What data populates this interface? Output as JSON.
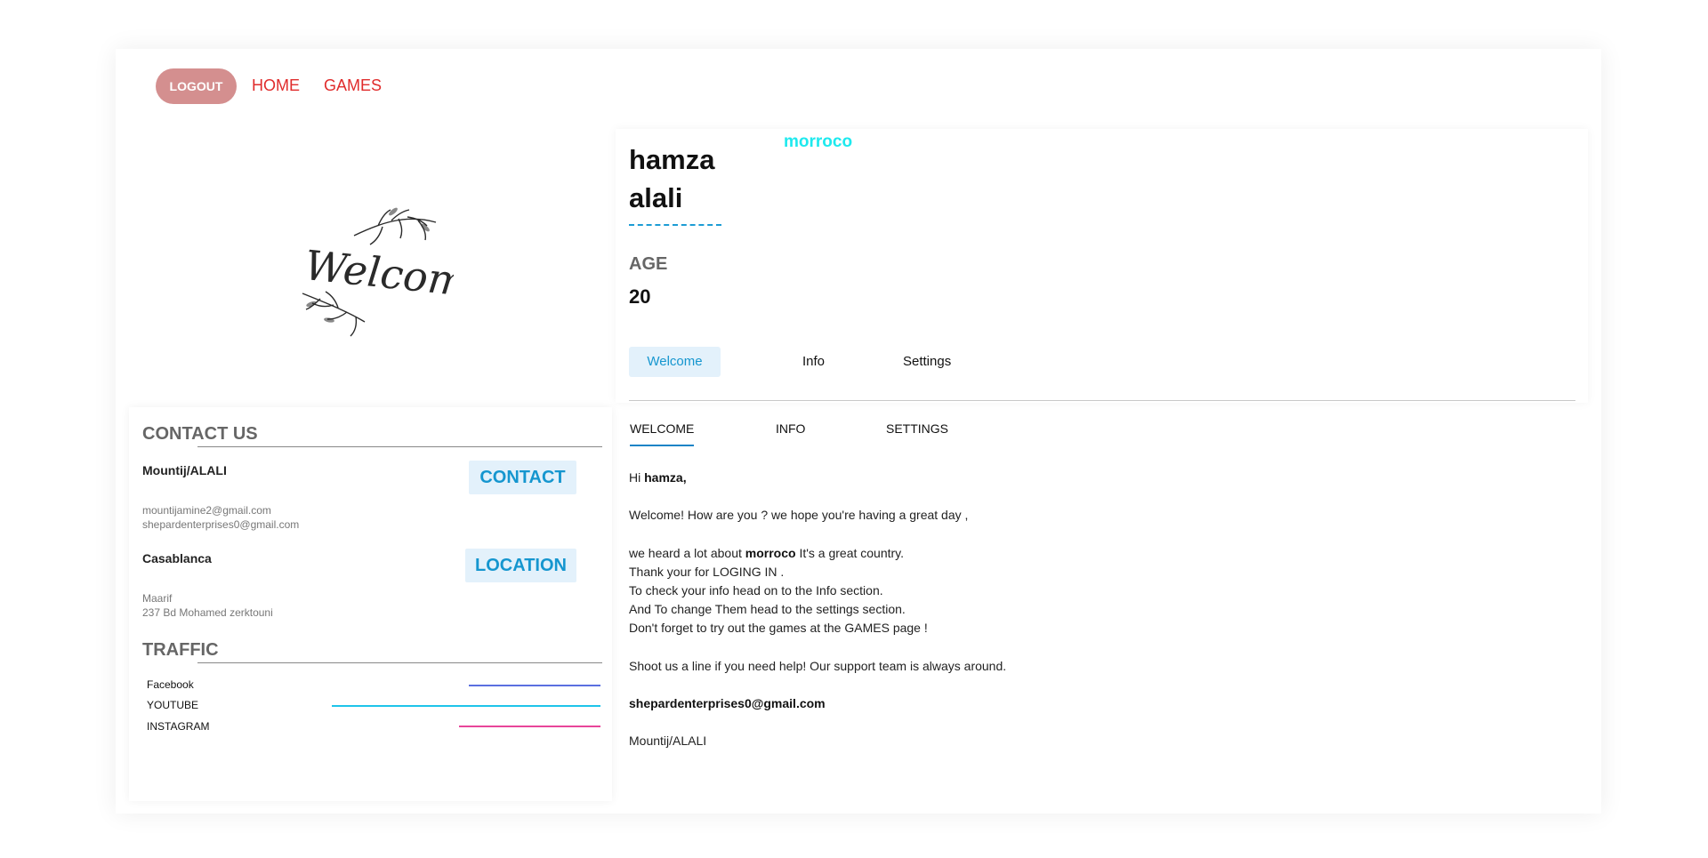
{
  "nav": {
    "logout": "LOGOUT",
    "home": "HOME",
    "games": "GAMES"
  },
  "welcome_art": {
    "text": "Welcome",
    "icon": "welcome-leaf-illustration"
  },
  "profile": {
    "first_name": "hamza",
    "last_name": "alali",
    "country": "morroco",
    "age_label": "AGE",
    "age": "20",
    "tabs": [
      "Welcome",
      "Info",
      "Settings"
    ],
    "active_tab": "Welcome"
  },
  "contact": {
    "title": "CONTACT US",
    "name": "Mountij/ALALI",
    "emails": [
      "mountijamine2@gmail.com",
      "shepardenterprises0@gmail.com"
    ],
    "contact_badge": "CONTACT",
    "city": "Casablanca",
    "address": [
      "Maarif",
      "237 Bd Mohamed zerktouni"
    ],
    "location_badge": "LOCATION"
  },
  "traffic": {
    "title": "TRAFFIC",
    "items": [
      {
        "label": "Facebook",
        "color": "#5b6fe0",
        "share": 0.28
      },
      {
        "label": "YOUTUBE",
        "color": "#1ec4ea",
        "share": 0.57
      },
      {
        "label": "INSTAGRAM",
        "color": "#e8459a",
        "share": 0.3
      }
    ]
  },
  "content": {
    "tabs": [
      "WELCOME",
      "INFO",
      "SETTINGS"
    ],
    "active_tab": "WELCOME",
    "greeting_prefix": "Hi",
    "greeting_name": "hamza,",
    "line_welcome": "Welcome! How are you ? we hope you're having a great day ,",
    "line_heard_prefix": "we heard a lot about",
    "line_heard_country": "morroco",
    "line_heard_suffix": "It's a great country.",
    "line_thanks": "Thank your for LOGING IN .",
    "line_info": "To check your info head on to the Info section.",
    "line_settings": "And To change Them head to the settings section.",
    "line_games": "Don't forget to try out the games at the GAMES page !",
    "line_support": "Shoot us a line if you need help! Our support team is always around.",
    "email": "shepardenterprises0@gmail.com",
    "signature": "Mountij/ALALI"
  },
  "colors": {
    "logout_bg": "#d48f8f",
    "nav_link": "#e02c2c",
    "accent": "#1596cf",
    "country": "#1ee9ee"
  }
}
